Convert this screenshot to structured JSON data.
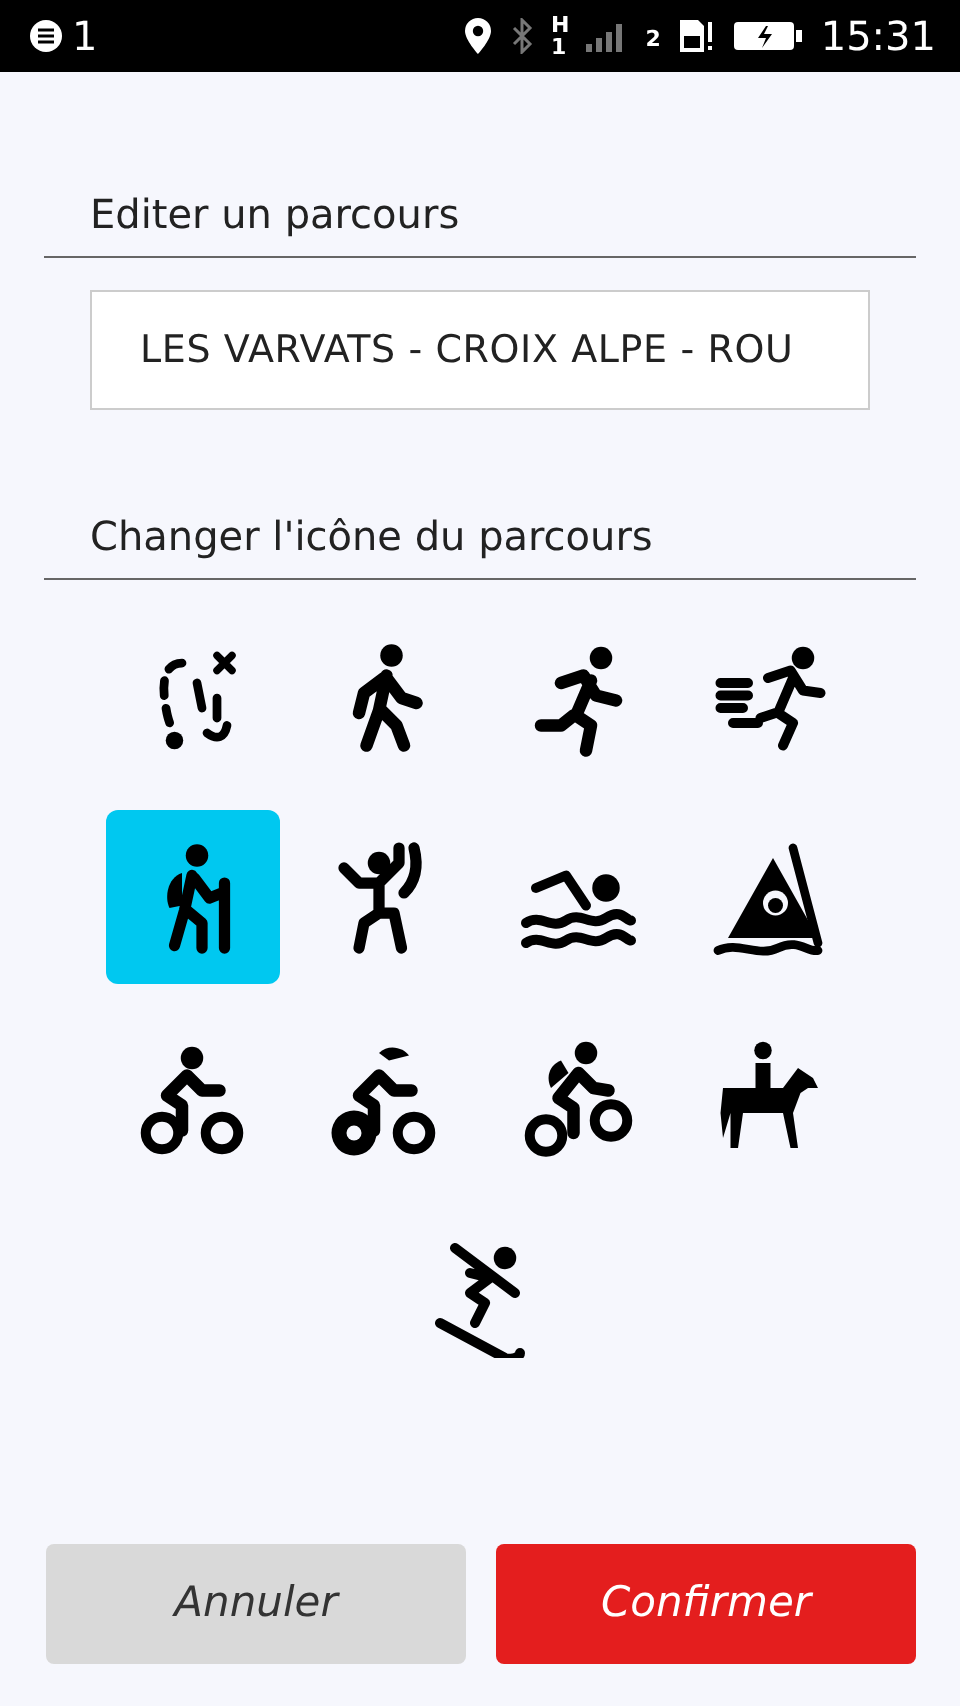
{
  "status_bar": {
    "notification_count": "1",
    "network_type": "H",
    "network_slot": "1",
    "sim_slot": "2",
    "time": "15:31"
  },
  "route_section": {
    "title": "Editer un parcours",
    "name_field": {
      "value": "LES VARVATS - CROIX ALPE - ROU"
    }
  },
  "icon_section": {
    "title": "Changer l'icône du parcours"
  },
  "icons": [
    {
      "kind": "route",
      "selected": false
    },
    {
      "kind": "walk",
      "selected": false
    },
    {
      "kind": "run",
      "selected": false
    },
    {
      "kind": "sprint",
      "selected": false
    },
    {
      "kind": "hike",
      "selected": true
    },
    {
      "kind": "climb",
      "selected": false
    },
    {
      "kind": "swim",
      "selected": false
    },
    {
      "kind": "kayak",
      "selected": false
    },
    {
      "kind": "bike",
      "selected": false
    },
    {
      "kind": "roadbike",
      "selected": false
    },
    {
      "kind": "mtb",
      "selected": false
    },
    {
      "kind": "horse",
      "selected": false
    },
    {
      "kind": "ski",
      "selected": false
    }
  ],
  "buttons": [
    {
      "label": "Annuler",
      "kind": "cancel"
    },
    {
      "label": "Confirmer",
      "kind": "confirm"
    }
  ]
}
